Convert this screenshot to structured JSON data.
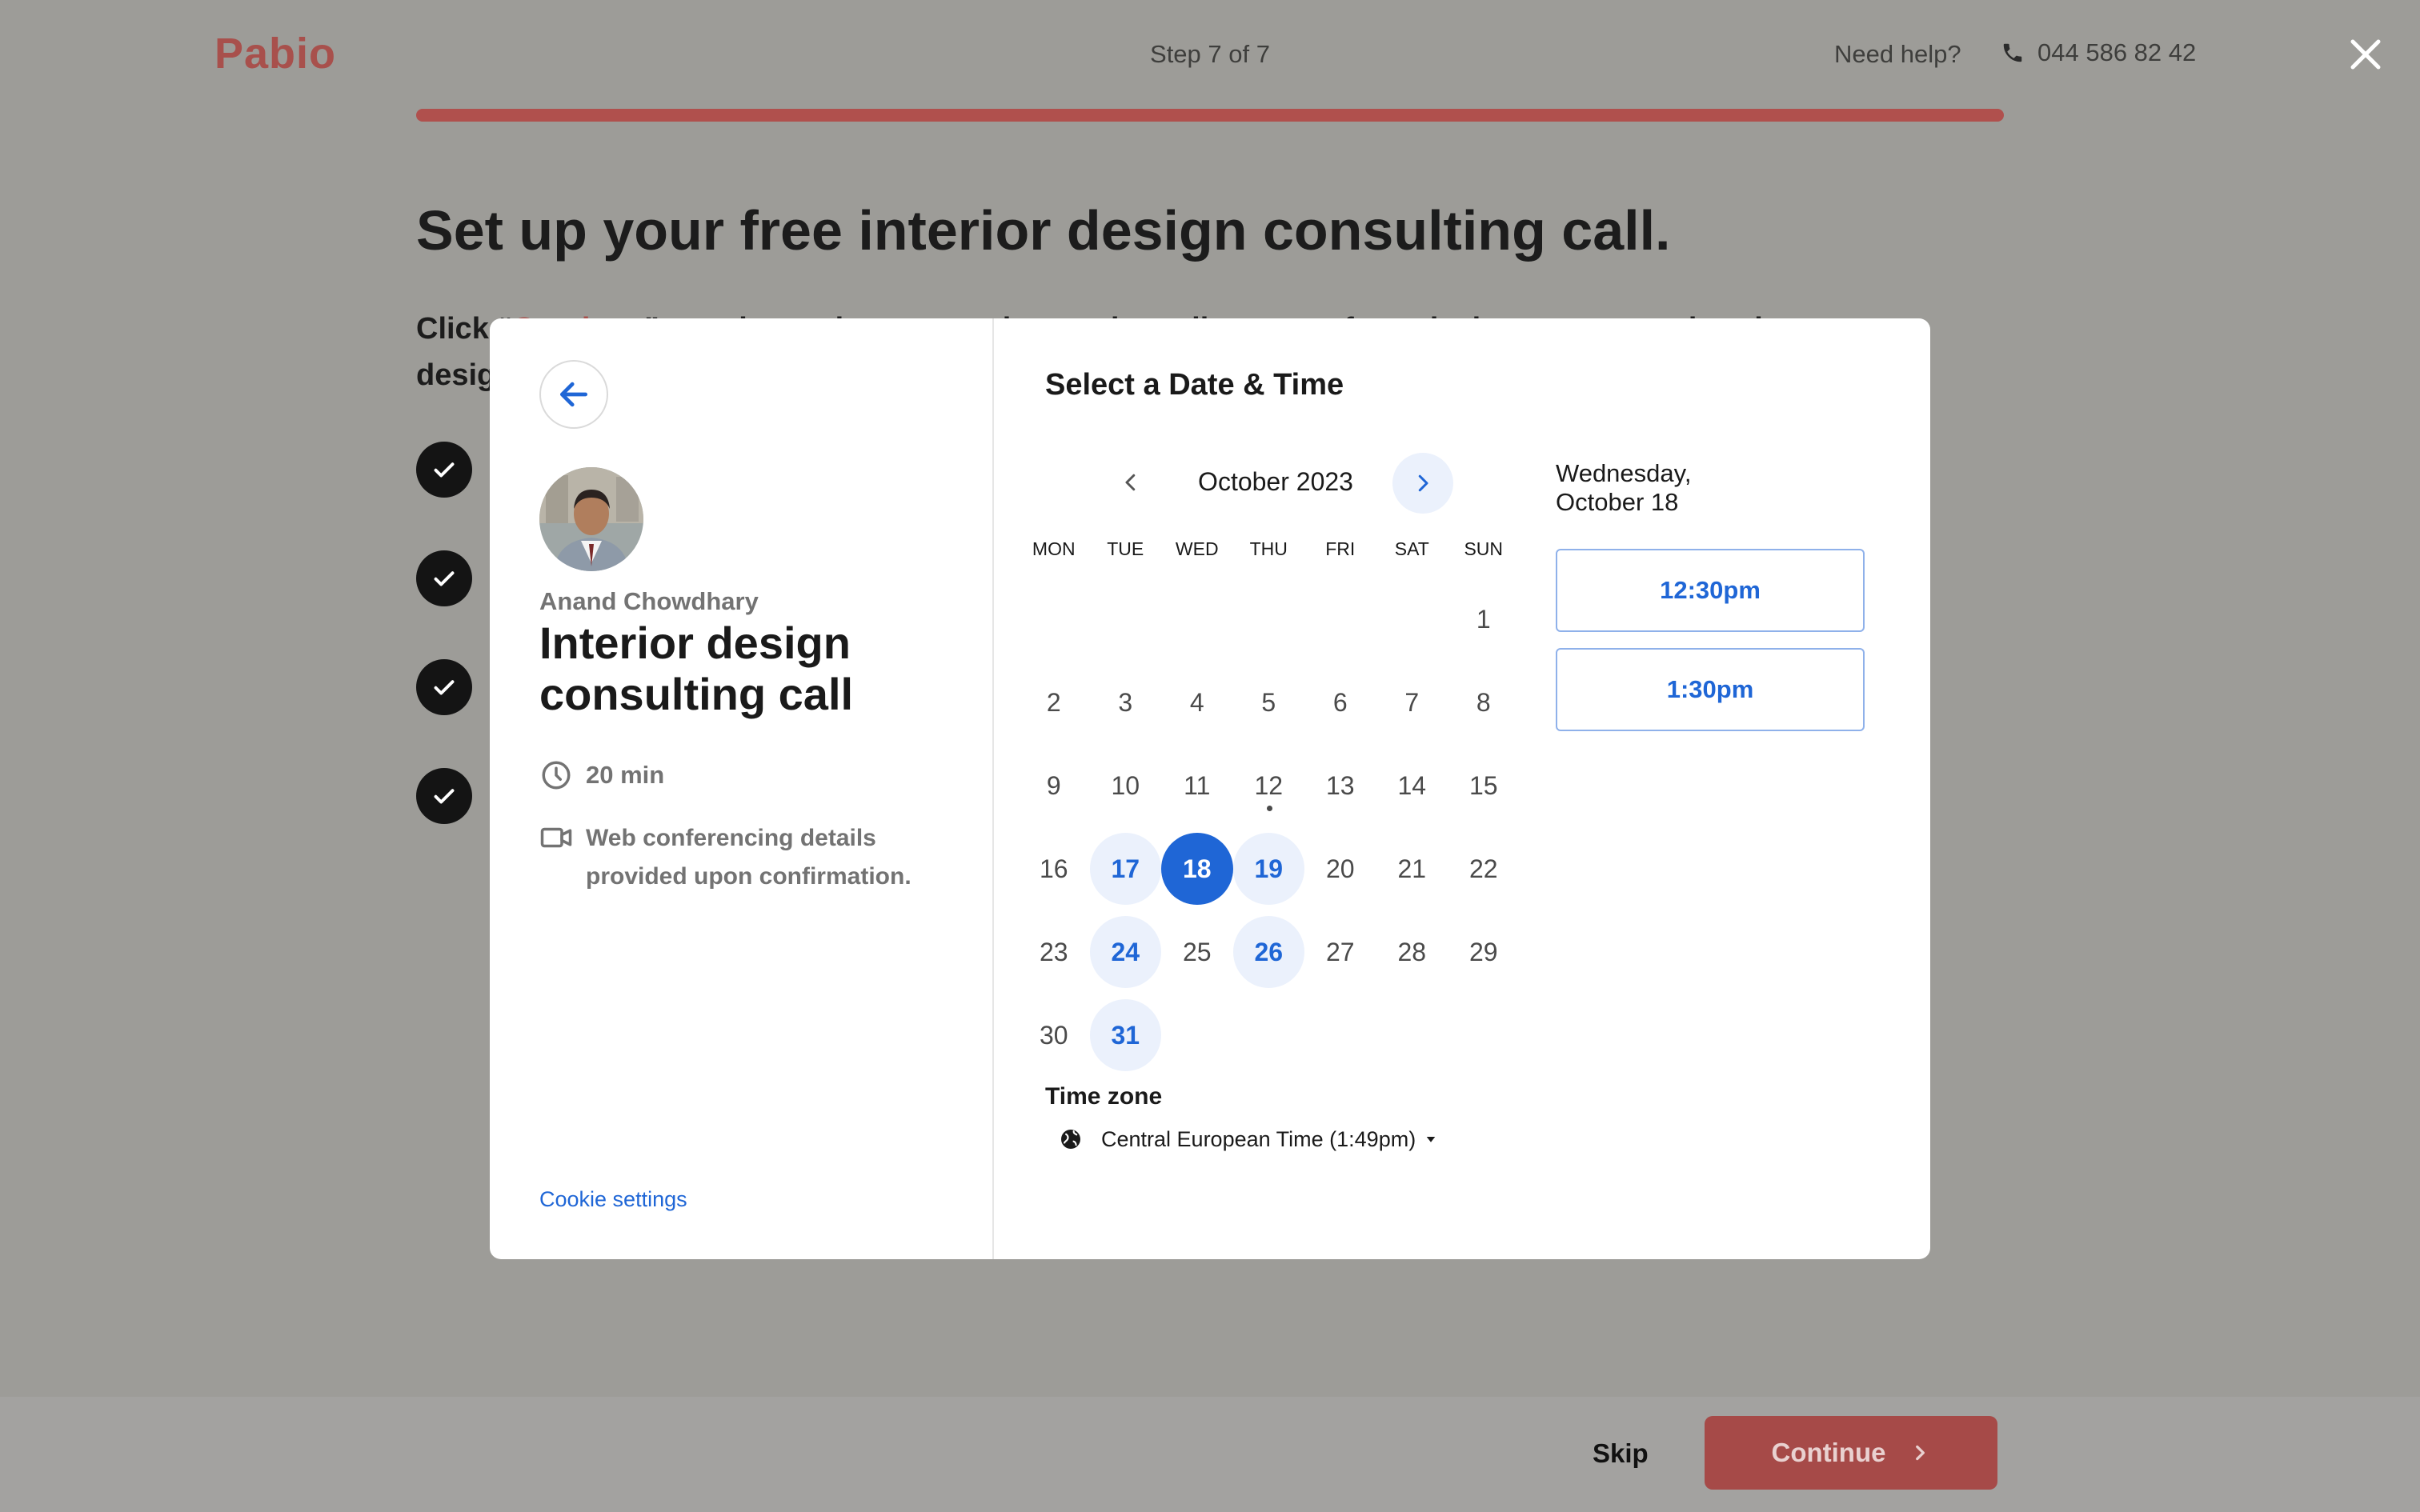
{
  "header": {
    "logo": "Pabio",
    "step": "Step 7 of 7",
    "help": "Need help?",
    "phone": "044 586 82 42"
  },
  "progress": {
    "percent": 100
  },
  "background": {
    "title": "Set up your free interior design consulting call.",
    "desc_start": "Click “",
    "desc_hl": "Continue",
    "desc_end": "” to select a time convenient and to talk to one of our design experts on interior",
    "desc_line2": "design"
  },
  "footer": {
    "skip": "Skip",
    "continue": "Continue"
  },
  "modal": {
    "host_name": "Anand Chowdhary",
    "event_title": "Interior design consulting call",
    "duration": "20 min",
    "conferencing": "Web conferencing details provided upon confirmation.",
    "cookie": "Cookie settings",
    "select_title": "Select a Date & Time",
    "month": "October 2023",
    "weekdays": [
      "MON",
      "TUE",
      "WED",
      "THU",
      "FRI",
      "SAT",
      "SUN"
    ],
    "days": [
      "",
      "",
      "",
      "",
      "",
      "",
      "1",
      "2",
      "3",
      "4",
      "5",
      "6",
      "7",
      "8",
      "9",
      "10",
      "11",
      "12",
      "13",
      "14",
      "15",
      "16",
      "17",
      "18",
      "19",
      "20",
      "21",
      "22",
      "23",
      "24",
      "25",
      "26",
      "27",
      "28",
      "29",
      "30",
      "31"
    ],
    "available_days": [
      "17",
      "19",
      "24",
      "26",
      "31"
    ],
    "selected_day": "18",
    "today_day": "12",
    "timezone_label": "Time zone",
    "timezone": "Central European Time (1:49pm)",
    "selected_date_label": "Wednesday, October 18",
    "slots": [
      "12:30pm",
      "1:30pm"
    ]
  },
  "colors": {
    "brand": "#a8504c",
    "accent": "#1f66d6",
    "accent_light": "#ebf1fc"
  }
}
